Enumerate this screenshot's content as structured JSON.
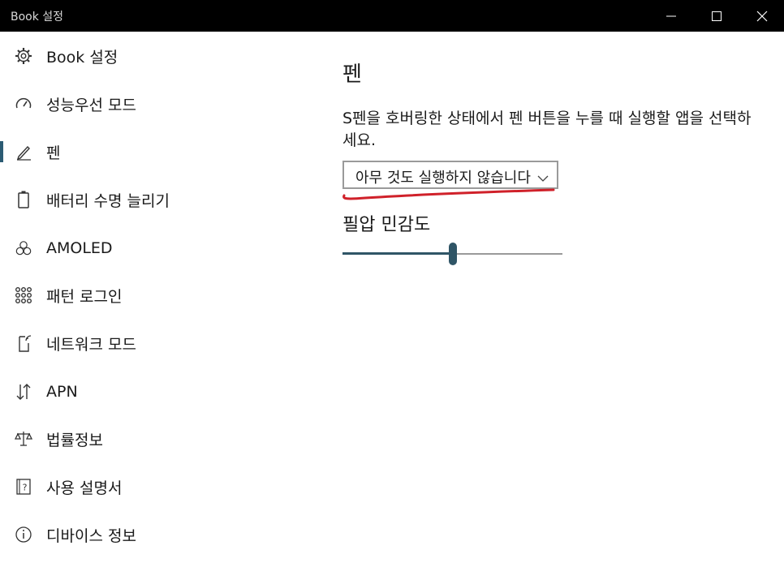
{
  "window": {
    "title": "Book 설정"
  },
  "sidebar": {
    "items": [
      {
        "label": "Book 설정",
        "icon": "gear-icon"
      },
      {
        "label": "성능우선 모드",
        "icon": "speedometer-icon"
      },
      {
        "label": "펜",
        "icon": "pen-icon",
        "active": true
      },
      {
        "label": "배터리 수명 늘리기",
        "icon": "battery-icon"
      },
      {
        "label": "AMOLED",
        "icon": "circles-icon"
      },
      {
        "label": "패턴 로그인",
        "icon": "pattern-grid-icon"
      },
      {
        "label": "네트워크 모드",
        "icon": "network-device-icon"
      },
      {
        "label": "APN",
        "icon": "up-down-arrows-icon"
      },
      {
        "label": "법률정보",
        "icon": "scales-icon"
      },
      {
        "label": "사용 설명서",
        "icon": "manual-question-icon"
      },
      {
        "label": "디바이스 정보",
        "icon": "info-icon"
      }
    ]
  },
  "main": {
    "title": "펜",
    "description": "S펜을 호버링한 상태에서 펜 버튼을 누를 때 실행할 앱을 선택하세요.",
    "dropdown": {
      "value": "아무 것도 실행하지 않습니다"
    },
    "slider": {
      "label": "필압 민감도",
      "value_fraction": 0.5
    }
  },
  "colors": {
    "titlebar": "#000000",
    "accent": "#2b5b73",
    "annotation": "#d0212a"
  }
}
